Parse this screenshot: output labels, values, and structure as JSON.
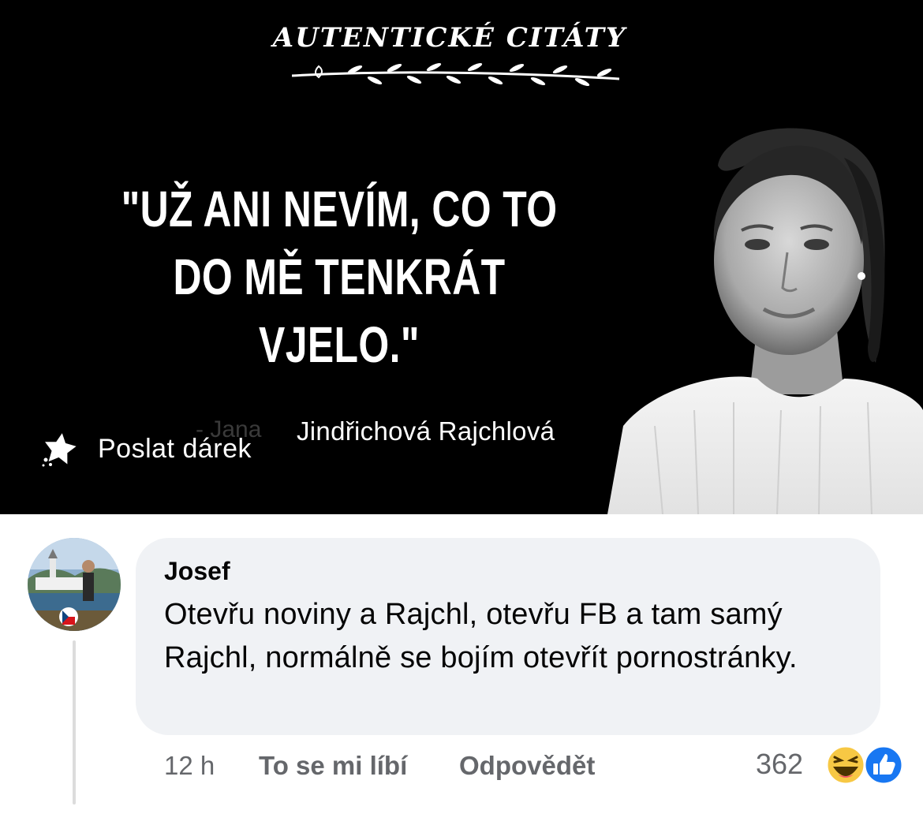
{
  "post": {
    "brand": "AUTENTICKÉ CITÁTY",
    "quote": "\"UŽ ANI NEVÍM, CO TO DO MĚ TENKRÁT VJELO.\"",
    "author_faded": "- Jana",
    "author": "Jindřichová Rajchlová",
    "gift_label": "Poslat dárek"
  },
  "comment": {
    "author": "Josef",
    "text": "Otevřu noviny a Rajchl, otevřu FB a tam samý Rajchl, normálně se bojím otevřít pornostránky.",
    "time": "12 h",
    "like_label": "To se mi líbí",
    "reply_label": "Odpovědět",
    "reaction_count": "362",
    "reactions": [
      "haha-icon",
      "like-icon"
    ]
  },
  "colors": {
    "image_bg": "#000000",
    "bubble_bg": "#f0f2f5",
    "meta_text": "#65676b",
    "like_blue": "#1877f2"
  }
}
